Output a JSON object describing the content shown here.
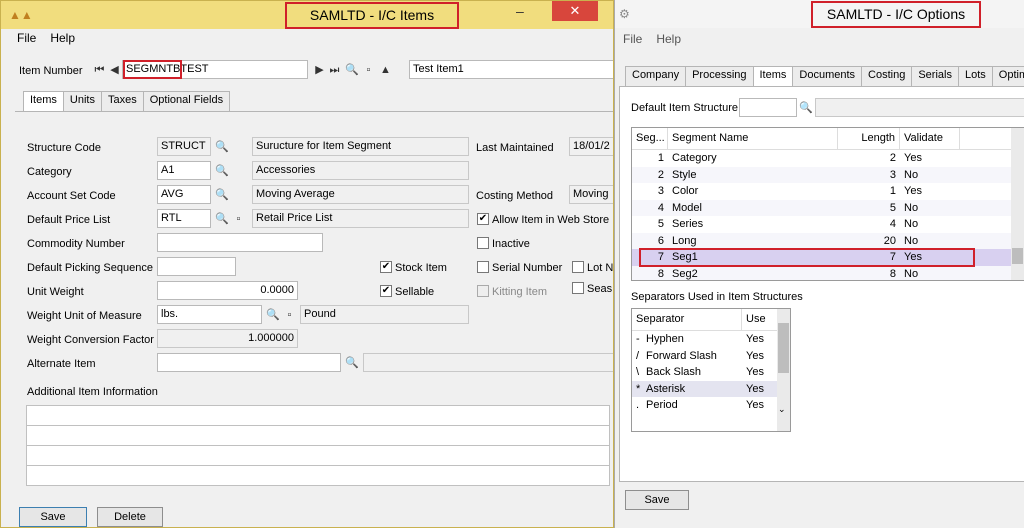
{
  "items_window": {
    "title": "SAMLTD - I/C Items",
    "menu": [
      "File",
      "Help"
    ],
    "item_number_label": "Item Number",
    "item_number_prefix": "SEGMNTB",
    "item_number_suffix": "TEST",
    "item_description": "Test Item1",
    "tabs": [
      "Items",
      "Units",
      "Taxes",
      "Optional Fields"
    ],
    "structure_code_label": "Structure Code",
    "structure_code": "STRUCT",
    "structure_desc": "Suructure for Item Segment",
    "category_label": "Category",
    "category": "A1",
    "category_desc": "Accessories",
    "account_set_label": "Account Set Code",
    "account_set": "AVG",
    "account_set_desc": "Moving Average",
    "price_list_label": "Default Price List",
    "price_list": "RTL",
    "price_list_desc": "Retail Price List",
    "commodity_label": "Commodity Number",
    "picking_seq_label": "Default Picking Sequence",
    "unit_weight_label": "Unit Weight",
    "unit_weight": "0.0000",
    "weight_uom_label": "Weight Unit of Measure",
    "weight_uom": "lbs.",
    "weight_uom_desc": "Pound",
    "weight_factor_label": "Weight Conversion Factor",
    "weight_factor": "1.000000",
    "alternate_item_label": "Alternate Item",
    "additional_info_label": "Additional Item Information",
    "last_maintained_label": "Last Maintained",
    "last_maintained": "18/01/2",
    "costing_method_label": "Costing Method",
    "costing_method": "Moving",
    "allow_web_label": "Allow Item in Web Store",
    "inactive_label": "Inactive",
    "stock_item_label": "Stock Item",
    "serial_number_label": "Serial Number",
    "lot_label": "Lot N",
    "sellable_label": "Sellable",
    "kitting_label": "Kitting Item",
    "seasonal_label": "Seas",
    "save_label": "Save",
    "delete_label": "Delete"
  },
  "options_window": {
    "title": "SAMLTD - I/C Options",
    "menu": [
      "File",
      "Help"
    ],
    "tabs": [
      "Company",
      "Processing",
      "Items",
      "Documents",
      "Costing",
      "Serials",
      "Lots",
      "Optimizer"
    ],
    "default_structure_label": "Default Item Structure",
    "segments_headers": [
      "Seg...",
      "Segment Name",
      "Length",
      "Validate"
    ],
    "segments": [
      {
        "seg": "1",
        "name": "Category",
        "length": "2",
        "validate": "Yes"
      },
      {
        "seg": "2",
        "name": "Style",
        "length": "3",
        "validate": "No"
      },
      {
        "seg": "3",
        "name": "Color",
        "length": "1",
        "validate": "Yes"
      },
      {
        "seg": "4",
        "name": "Model",
        "length": "5",
        "validate": "No"
      },
      {
        "seg": "5",
        "name": "Series",
        "length": "4",
        "validate": "No"
      },
      {
        "seg": "6",
        "name": "Long",
        "length": "20",
        "validate": "No"
      },
      {
        "seg": "7",
        "name": "Seg1",
        "length": "7",
        "validate": "Yes"
      },
      {
        "seg": "8",
        "name": "Seg2",
        "length": "8",
        "validate": "No"
      }
    ],
    "separators_label": "Separators Used in Item Structures",
    "separators_headers": [
      "Separator",
      "Use"
    ],
    "separators": [
      {
        "sym": "-",
        "name": "Hyphen",
        "use": "Yes"
      },
      {
        "sym": "/",
        "name": "Forward Slash",
        "use": "Yes"
      },
      {
        "sym": "\\",
        "name": "Back Slash",
        "use": "Yes"
      },
      {
        "sym": "*",
        "name": "Asterisk",
        "use": "Yes"
      },
      {
        "sym": ".",
        "name": "Period",
        "use": "Yes"
      }
    ],
    "save_label": "Save"
  }
}
